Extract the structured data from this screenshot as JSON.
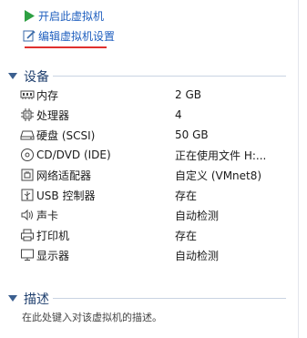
{
  "actions": {
    "start": "开启此虚拟机",
    "edit": "编辑虚拟机设置"
  },
  "devices_section": {
    "title": "设备",
    "items": [
      {
        "icon": "memory-icon",
        "name": "内存",
        "value": "2 GB"
      },
      {
        "icon": "processor-icon",
        "name": "处理器",
        "value": "4"
      },
      {
        "icon": "hard-disk-icon",
        "name": "硬盘 (SCSI)",
        "value": "50 GB"
      },
      {
        "icon": "cd-dvd-icon",
        "name": "CD/DVD (IDE)",
        "value": "正在使用文件 H:..."
      },
      {
        "icon": "network-adapter-icon",
        "name": "网络适配器",
        "value": "自定义 (VMnet8)"
      },
      {
        "icon": "usb-controller-icon",
        "name": "USB 控制器",
        "value": "存在"
      },
      {
        "icon": "sound-card-icon",
        "name": "声卡",
        "value": "自动检测"
      },
      {
        "icon": "printer-icon",
        "name": "打印机",
        "value": "存在"
      },
      {
        "icon": "display-icon",
        "name": "显示器",
        "value": "自动检测"
      }
    ]
  },
  "description_section": {
    "title": "描述",
    "placeholder": "在此处键入对该虚拟机的描述。"
  },
  "colors": {
    "link": "#1f5fbf",
    "play_green": "#2ea043",
    "accent_red": "#e0302e",
    "section_title": "#1f3f6e"
  }
}
